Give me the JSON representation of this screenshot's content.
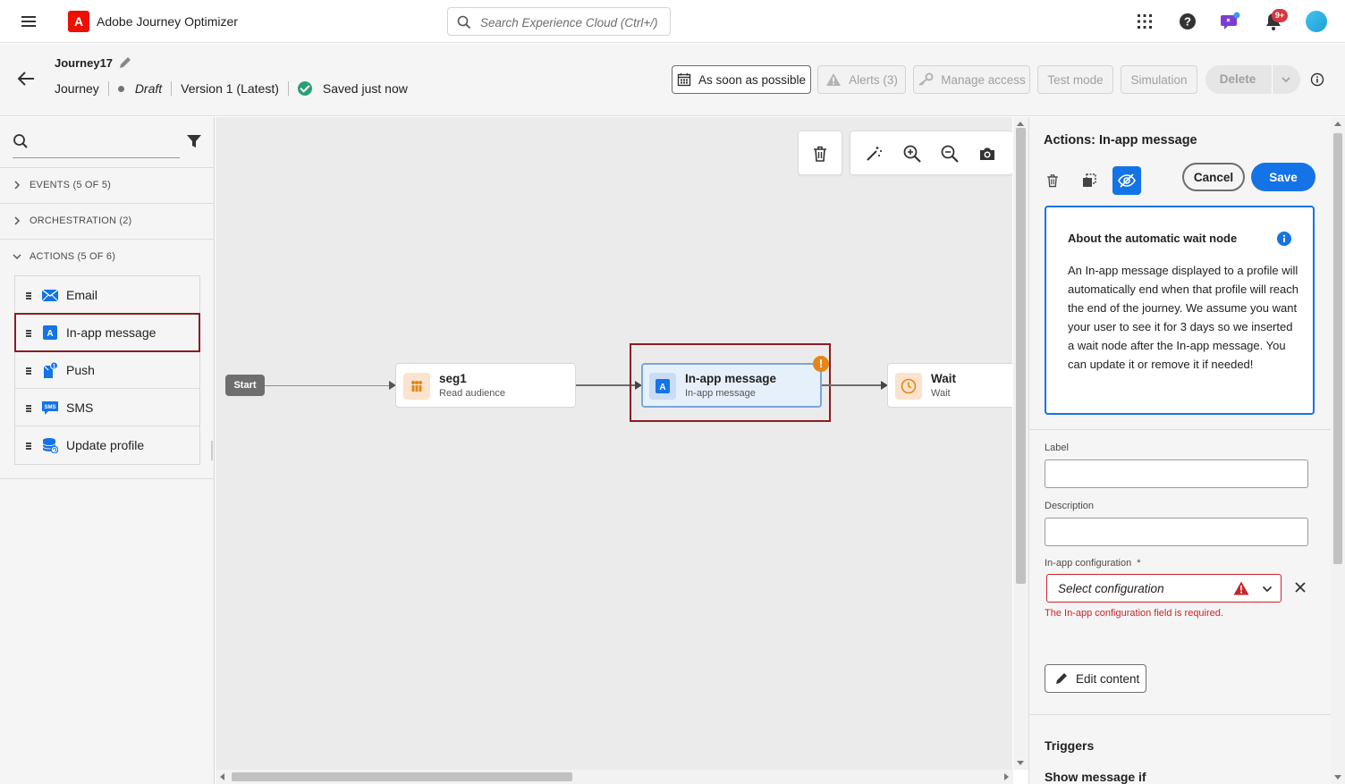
{
  "app": {
    "title": "Adobe Journey Optimizer",
    "logo_letter": "A",
    "search_placeholder": "Search Experience Cloud (Ctrl+/)",
    "notifications_badge": "9+"
  },
  "header": {
    "journey_name": "Journey17",
    "type": "Journey",
    "status": "Draft",
    "version": "Version 1 (Latest)",
    "saved": "Saved just now",
    "buttons": {
      "schedule": "As soon as possible",
      "alerts": "Alerts (3)",
      "manage_access": "Manage access",
      "test_mode": "Test mode",
      "simulation": "Simulation",
      "delete": "Delete"
    }
  },
  "left_panel": {
    "sections": {
      "events": "EVENTS (5 OF 5)",
      "orchestration": "ORCHESTRATION (2)",
      "actions": "ACTIONS (5 OF 6)"
    },
    "actions": [
      {
        "label": "Email",
        "icon": "email-icon"
      },
      {
        "label": "In-app message",
        "icon": "in-app-message-icon",
        "selected": true
      },
      {
        "label": "Push",
        "icon": "push-icon"
      },
      {
        "label": "SMS",
        "icon": "sms-icon"
      },
      {
        "label": "Update profile",
        "icon": "update-profile-icon"
      }
    ]
  },
  "canvas": {
    "start_label": "Start",
    "nodes": [
      {
        "title": "seg1",
        "subtitle": "Read audience"
      },
      {
        "title": "In-app message",
        "subtitle": "In-app message",
        "icon_letter": "A"
      },
      {
        "title": "Wait",
        "subtitle": "Wait"
      }
    ],
    "warning_glyph": "!"
  },
  "right_panel": {
    "title": "Actions: In-app message",
    "cancel": "Cancel",
    "save": "Save",
    "info_box": {
      "title": "About the automatic wait node",
      "body": "An In-app message displayed to a profile will automatically end when that profile will reach the end of the journey. We assume you want your user to see it for 3 days so we inserted a wait node after the In-app message. You can update it or remove it if needed!"
    },
    "label_field": "Label",
    "description_field": "Description",
    "config_field": "In-app configuration",
    "required_marker": "*",
    "config_placeholder": "Select configuration",
    "config_error": "The In-app configuration field is required.",
    "edit_content": "Edit content",
    "triggers": "Triggers",
    "show_message_if": "Show message if"
  },
  "colors": {
    "accent": "#1473e6",
    "error": "#c9252d",
    "warning": "#e68619",
    "highlight_frame": "#8b1d23",
    "adobe_red": "#eb1000"
  }
}
